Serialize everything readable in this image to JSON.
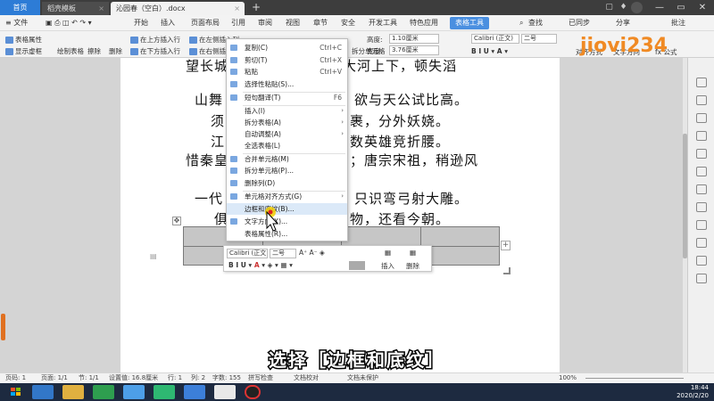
{
  "titlebar": {
    "home_tab": "首页",
    "tab1": "稻壳模板",
    "tab2": "沁园春（空白）.docx",
    "add": "+",
    "close": "×"
  },
  "menubar": {
    "file": "≡ 文件",
    "items": [
      "开始",
      "插入",
      "页面布局",
      "引用",
      "审阅",
      "视图",
      "章节",
      "安全",
      "开发工具",
      "特色应用"
    ],
    "active": "表格工具",
    "search": "查找",
    "sync": "已同步",
    "share": "分享",
    "comment": "批注"
  },
  "toolbar": {
    "table_props": "表格属性",
    "show_grid": "显示虚框",
    "draw_table": "绘制表格",
    "erase": "擦除",
    "delete": "删除",
    "insert_above": "在上方插入行",
    "insert_below": "在下方插入行",
    "insert_left": "在左侧插入列",
    "insert_right": "在右侧插入列",
    "split_cells": "拆分单元格",
    "height_label": "高度:",
    "height_value": "1.10厘米",
    "width_label": "宽度:",
    "width_value": "3.76厘米",
    "font_name": "Calibri (正文)",
    "font_size": "二号",
    "align": "对齐方式",
    "text_dir": "文字方向",
    "formula": "fx 公式"
  },
  "poem": {
    "line1": "望长城内外，惟余莽莽；大河上下，顿失滔",
    "line2a": "山舞",
    "line2b": "欲与天公试比高。",
    "line3a": "须",
    "line3b": "裹，分外妖娆。",
    "line4a": "江",
    "line4b": "数英雄竞折腰。",
    "line5a": "惜秦皇",
    "line5b": "；唐宗宋祖，稍逊风",
    "line6a": "一代",
    "line6b": "只识弯弓射大雕。",
    "line7a": "俱",
    "line7b": "物，还看今朝。"
  },
  "context_menu": {
    "items": [
      {
        "label": "复制(C)",
        "shortcut": "Ctrl+C"
      },
      {
        "label": "剪切(T)",
        "shortcut": "Ctrl+X"
      },
      {
        "label": "粘贴",
        "shortcut": "Ctrl+V"
      },
      {
        "label": "选择性粘贴(S)...",
        "shortcut": ""
      },
      {
        "label": "短句翻译(T)",
        "shortcut": "F6"
      },
      {
        "label": "插入(I)",
        "shortcut": ""
      },
      {
        "label": "拆分表格(A)",
        "shortcut": ""
      },
      {
        "label": "自动调整(A)",
        "shortcut": ""
      },
      {
        "label": "全选表格(L)",
        "shortcut": ""
      },
      {
        "label": "合并单元格(M)",
        "shortcut": ""
      },
      {
        "label": "拆分单元格(P)...",
        "shortcut": ""
      },
      {
        "label": "删除列(D)",
        "shortcut": ""
      },
      {
        "label": "单元格对齐方式(G)",
        "shortcut": ""
      },
      {
        "label": "边框和底纹(B)...",
        "shortcut": ""
      },
      {
        "label": "文字方向(X)...",
        "shortcut": ""
      },
      {
        "label": "表格属性(R)...",
        "shortcut": ""
      }
    ]
  },
  "mini_toolbar": {
    "font": "Calibri (正文",
    "size": "二号",
    "insert": "插入",
    "delete": "删除"
  },
  "statusbar": {
    "page": "页码: 1",
    "pages": "页面: 1/1",
    "section": "节: 1/1",
    "setting": "设置值: 16.8厘米",
    "row": "行: 1",
    "col": "列: 2",
    "words": "字数: 155",
    "spell": "拼写检查",
    "proof": "文档校对",
    "unprotected": "文档未保护",
    "zoom": "100%"
  },
  "taskbar": {
    "time": "18:44",
    "date": "2020/2/20"
  },
  "subtitle": "选择［边框和底纹］",
  "logo_text": "jiovi234",
  "colors": {
    "accent": "#4a8fe0",
    "tab_home": "#2d7cd6",
    "logo": "#f08a24"
  }
}
